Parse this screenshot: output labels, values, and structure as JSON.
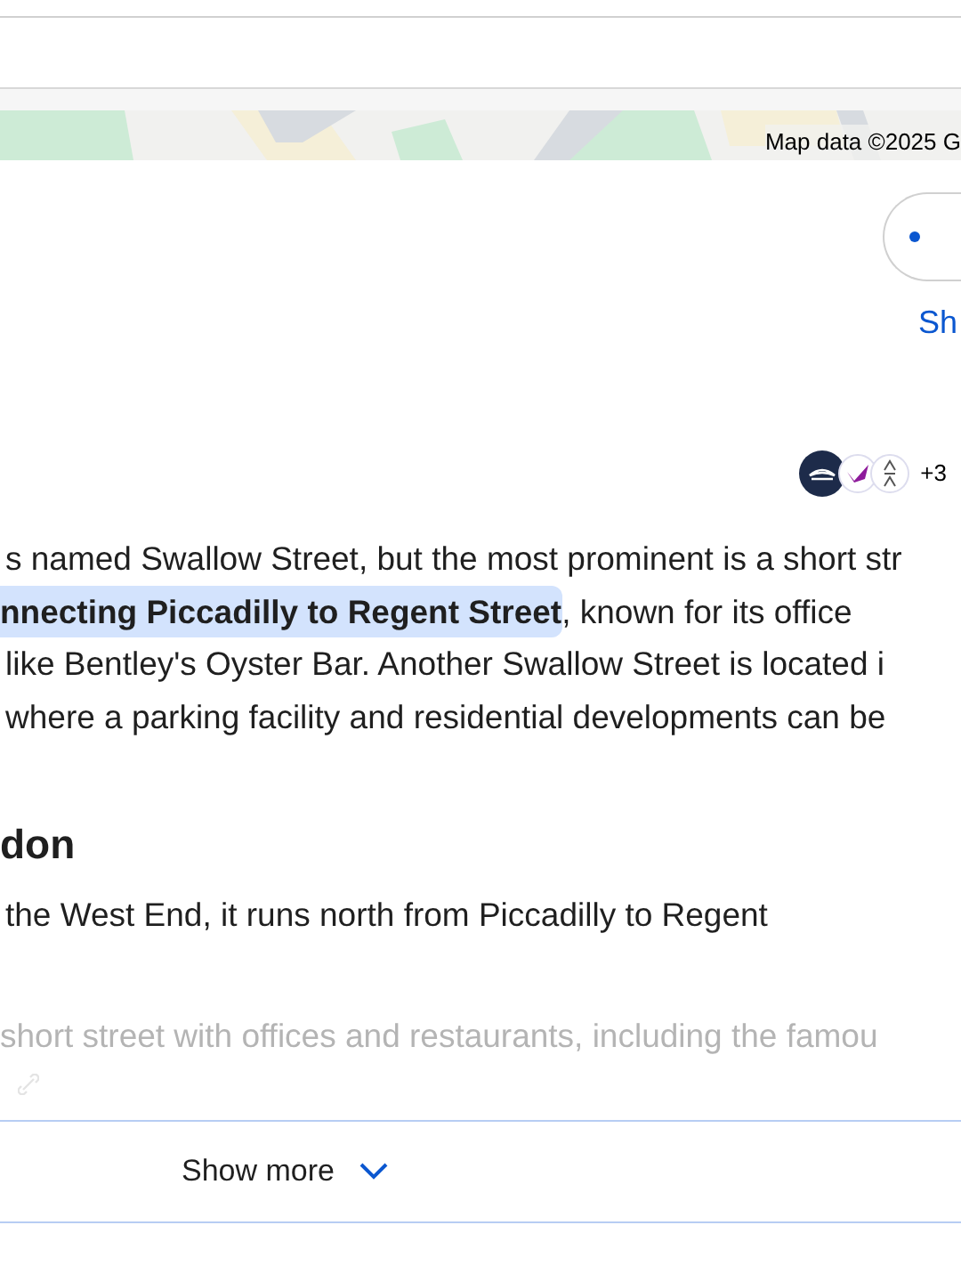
{
  "map": {
    "attribution": "Map data ©2025 G"
  },
  "share": {
    "label": "Sh"
  },
  "sources": {
    "more": "+3"
  },
  "answer": {
    "lines": [
      {
        "text": "s named Swallow Street, but the most prominent is a short str"
      },
      {
        "highlight": "nnecting Piccadilly to Regent Street",
        "text": ", known for its office"
      },
      {
        "text": "like Bentley's Oyster Bar. Another Swallow Street is located i"
      },
      {
        "text": "where a parking facility and residential developments can be"
      }
    ]
  },
  "section": {
    "heading": "don",
    "text": "the West End, it runs north from Piccadilly to Regent",
    "faded": "short street with offices and restaurants, including the famou"
  },
  "show_more": {
    "label": "Show more"
  }
}
